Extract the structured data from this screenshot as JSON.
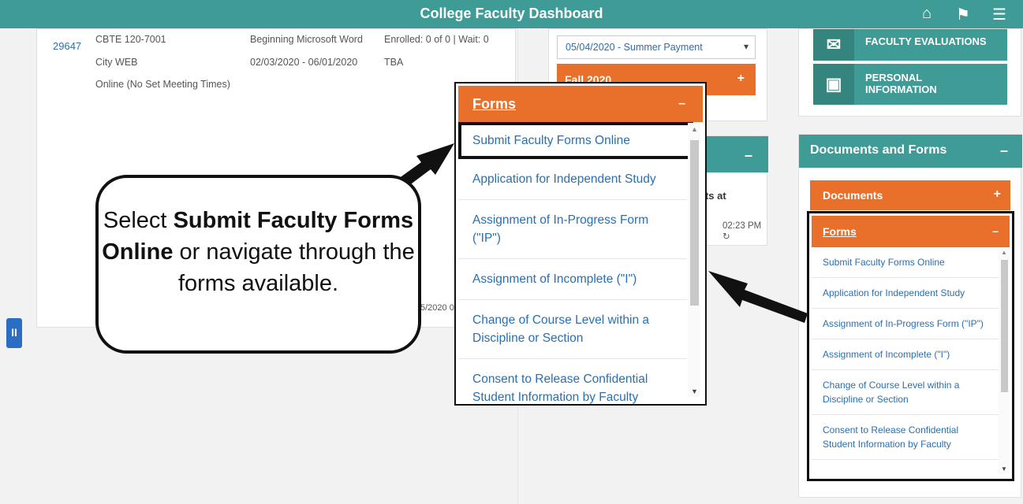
{
  "header": {
    "title": "College Faculty Dashboard",
    "icons": [
      "home-icon",
      "flag-icon",
      "menu-icon"
    ]
  },
  "class_row": {
    "id": "29647",
    "course": "CBTE 120-7001",
    "campus": "City WEB",
    "meeting": "Online (No Set Meeting Times)",
    "name": "Beginning Microsoft Word",
    "dates": "02/03/2020 - 06/01/2020",
    "enrolled": "Enrolled: 0 of 0 | Wait: 0",
    "location": "TBA",
    "partial_date": "5/2020 0"
  },
  "payments": {
    "selected": "05/04/2020 - Summer Payment",
    "term": "Fall 2020"
  },
  "mid_card": {
    "text1": "nts at",
    "text2": "02:23 PM"
  },
  "tiles": [
    {
      "label_line1": "FACULTY EVALUATIONS",
      "label_line2": "",
      "icon": "evaluations-icon"
    },
    {
      "label_line1": "PERSONAL",
      "label_line2": "INFORMATION",
      "icon": "personal-info-icon"
    }
  ],
  "documents": {
    "title": "Documents and Forms",
    "sub_documents": "Documents",
    "forms_label": "Forms"
  },
  "forms_items": [
    "Submit Faculty Forms Online",
    "Application for Independent Study",
    "Assignment of In-Progress Form (\"IP\")",
    "Assignment of Incomplete (\"I\")",
    "Change of Course Level within a Discipline or Section",
    "Consent to Release Confidential Student Information by Faculty"
  ],
  "callout": {
    "pre": "Select ",
    "bold": "Submit Faculty Forms Online",
    "post": " or navigate through the forms available."
  },
  "side_handle": "II",
  "colors": {
    "teal": "#3e9b96",
    "orange": "#e8702a",
    "link": "#2a6fb0"
  }
}
